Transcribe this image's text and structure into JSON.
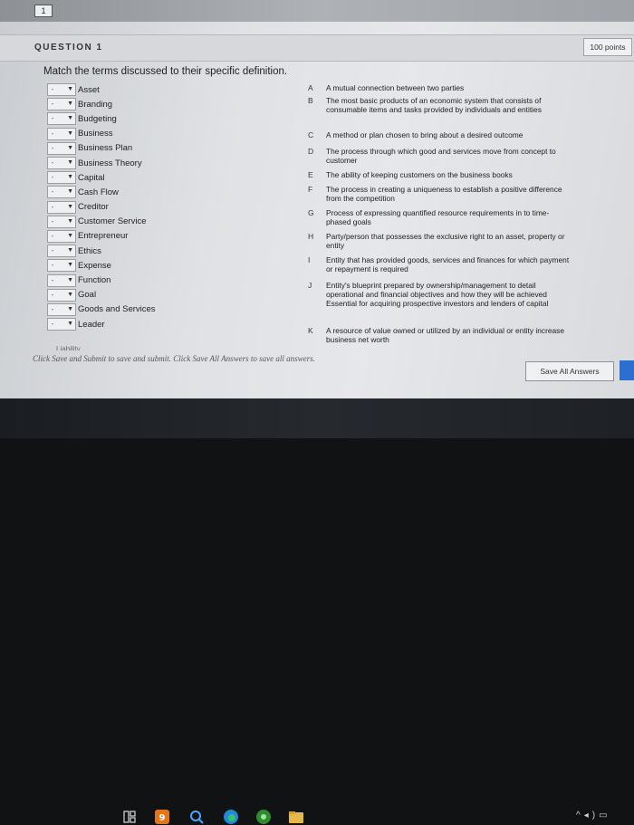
{
  "page_indicator": "1",
  "question": {
    "title": "QUESTION 1",
    "points": "100 points",
    "instruction": "Match the terms discussed to their specific definition."
  },
  "terms": [
    "Asset",
    "Branding",
    "Budgeting",
    "Business",
    "Business Plan",
    "Business Theory",
    "Capital",
    "Cash Flow",
    "Creditor",
    "Customer Service",
    "Entrepreneur",
    "Ethics",
    "Expense",
    "Function",
    "Goal",
    "Goods and Services",
    "Leader"
  ],
  "cut_off_term": "Liability",
  "select_dash": "-",
  "definitions": [
    {
      "letter": "A",
      "text": "A mutual connection between two parties"
    },
    {
      "letter": "B",
      "text": "The most basic products of an economic system that consists of consumable items and tasks provided by individuals and entities"
    },
    {
      "letter": "C",
      "text": "A method or plan chosen to bring about a desired outcome"
    },
    {
      "letter": "D",
      "text": "The process through which good and services move from concept to customer"
    },
    {
      "letter": "E",
      "text": "The ability of keeping customers on the business books"
    },
    {
      "letter": "F",
      "text": "The process in creating a uniqueness to establish a positive difference from the competition"
    },
    {
      "letter": "G",
      "text": "Process of expressing quantified resource requirements in to time-phased goals"
    },
    {
      "letter": "H",
      "text": "Party/person that possesses the exclusive right to an asset, property or entity"
    },
    {
      "letter": "I",
      "text": "Entity that has provided goods, services and finances for which payment or repayment is required"
    },
    {
      "letter": "J",
      "text": "Entity's blueprint prepared by ownership/management to detail operational and financial objectives and how they will be achieved Essential for acquiring prospective investors and lenders of capital"
    },
    {
      "letter": "K",
      "text": "A resource of value owned or utilized by an individual or entity increase business net worth"
    }
  ],
  "footer": {
    "hint": "Click Save and Submit to save and submit. Click Save All Answers to save all answers.",
    "save_all_label": "Save All Answers"
  },
  "taskbar_icons": [
    "task-view-icon",
    "yahoo-icon",
    "search-icon",
    "edge-icon",
    "xbox-icon",
    "file-explorer-icon"
  ],
  "colors": {
    "accent_blue": "#2c6fd1",
    "taskbar": "#1e2125"
  }
}
